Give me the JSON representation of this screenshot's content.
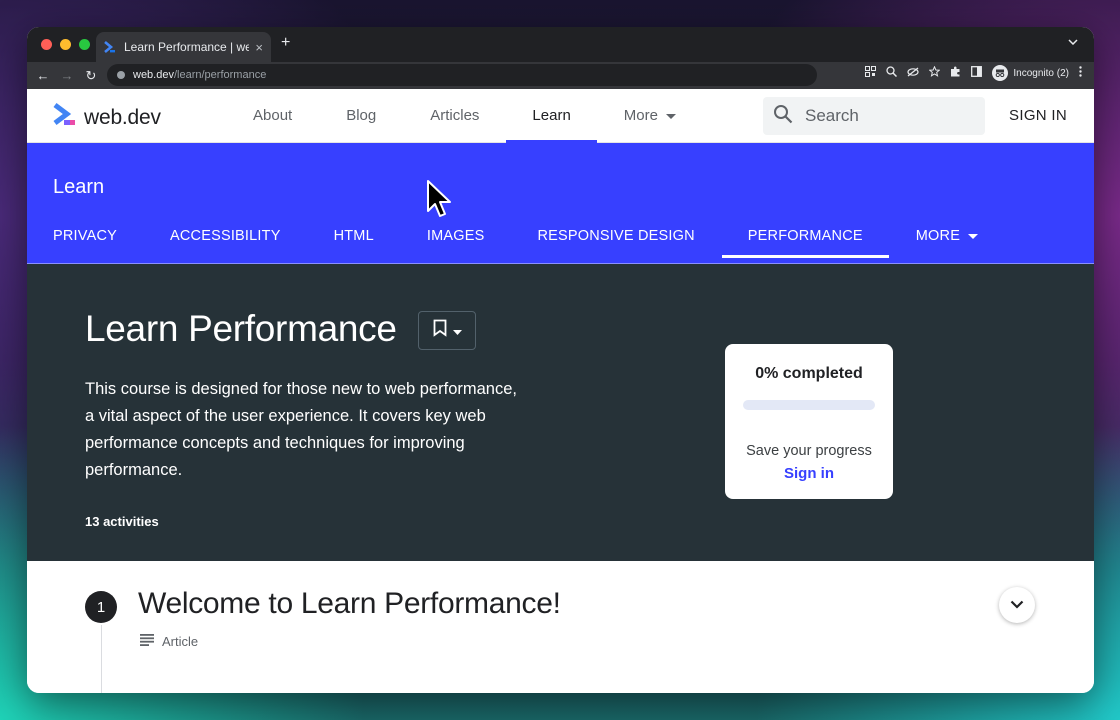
{
  "browser": {
    "tab_title": "Learn Performance  |  we",
    "tab_close": "×",
    "new_tab": "+",
    "tab_menu": "⌄",
    "url_host": "web.dev",
    "url_path": "/learn/performance",
    "incognito_label": "Incognito (2)",
    "nav": {
      "back": "←",
      "forward": "→",
      "reload": "↻"
    }
  },
  "site_header": {
    "logo_text": "web.dev",
    "nav": [
      {
        "label": "About"
      },
      {
        "label": "Blog"
      },
      {
        "label": "Articles"
      },
      {
        "label": "Learn",
        "active": true
      },
      {
        "label": "More"
      }
    ],
    "search_placeholder": "Search",
    "sign_in": "SIGN IN"
  },
  "band": {
    "title": "Learn",
    "subnav": [
      {
        "label": "PRIVACY"
      },
      {
        "label": "ACCESSIBILITY"
      },
      {
        "label": "HTML"
      },
      {
        "label": "IMAGES"
      },
      {
        "label": "RESPONSIVE DESIGN"
      },
      {
        "label": "PERFORMANCE",
        "active": true
      },
      {
        "label": "MORE"
      }
    ]
  },
  "hero": {
    "title": "Learn Performance",
    "description": "This course is designed for those new to web performance, a vital aspect of the user experience. It covers key web performance concepts and techniques for improving performance.",
    "activities": "13 activities"
  },
  "progress_card": {
    "completed": "0% completed",
    "progress_value": 0,
    "save_text": "Save your progress",
    "sign_in": "Sign in"
  },
  "step": {
    "number": "1",
    "title": "Welcome to Learn Performance!",
    "type": "Article"
  },
  "colors": {
    "brand_blue": "#3740ff",
    "hero_bg": "#263238",
    "chrome_dark": "#202124"
  }
}
